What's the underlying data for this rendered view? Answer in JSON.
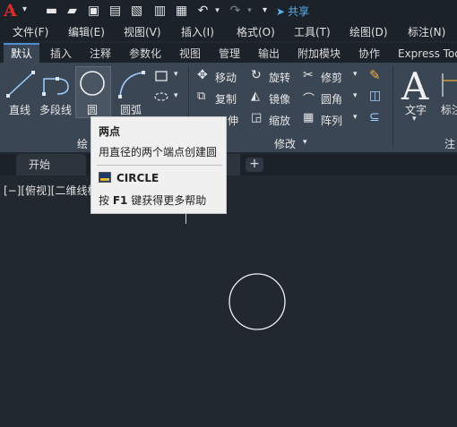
{
  "quick_access": {
    "logo_letter": "A",
    "share_label": "共享",
    "icons": [
      "new-file-icon",
      "open-folder-icon",
      "save-icon",
      "save-as-icon",
      "plot-preview-icon",
      "export-icon",
      "import-icon",
      "print-icon",
      "undo-icon",
      "redo-icon",
      "qat-dropdown-icon",
      "share-icon"
    ]
  },
  "menu": [
    {
      "label": "文件(F)"
    },
    {
      "label": "编辑(E)"
    },
    {
      "label": "视图(V)"
    },
    {
      "label": "插入(I)"
    },
    {
      "label": "格式(O)"
    },
    {
      "label": "工具(T)"
    },
    {
      "label": "绘图(D)"
    },
    {
      "label": "标注(N)"
    }
  ],
  "ribbon_tabs": [
    {
      "label": "默认",
      "active": true
    },
    {
      "label": "插入"
    },
    {
      "label": "注释"
    },
    {
      "label": "参数化"
    },
    {
      "label": "视图"
    },
    {
      "label": "管理"
    },
    {
      "label": "输出"
    },
    {
      "label": "附加模块"
    },
    {
      "label": "协作"
    },
    {
      "label": "Express Too"
    }
  ],
  "draw_panel": {
    "line": "直线",
    "polyline": "多段线",
    "circle": "圆",
    "arc": "圆弧",
    "title_visible": "绘"
  },
  "modify_panel": {
    "move": "移动",
    "rotate": "旋转",
    "trim": "修剪",
    "copy": "复制",
    "mirror": "镜像",
    "fillet": "圆角",
    "stretch_partial": "伸",
    "scale": "缩放",
    "array": "阵列",
    "title": "修改"
  },
  "annotation_panel": {
    "text": "文字",
    "dimension": "标注",
    "title_partial": "注"
  },
  "document_tabs": {
    "start": "开始",
    "new_tab": "+"
  },
  "viewport": {
    "label": "[−][俯视][二维线框"
  },
  "tooltip": {
    "title": "两点",
    "description": "用直径的两个端点创建圆",
    "command": "CIRCLE",
    "help_prefix": "按 ",
    "help_key": "F1",
    "help_suffix": " 键获得更多帮助"
  },
  "colors": {
    "accent": "#4c8fd6",
    "logo": "#e02b2b",
    "share": "#5ab0f0",
    "canvas": "#212830",
    "ribbon": "#3b4654"
  }
}
